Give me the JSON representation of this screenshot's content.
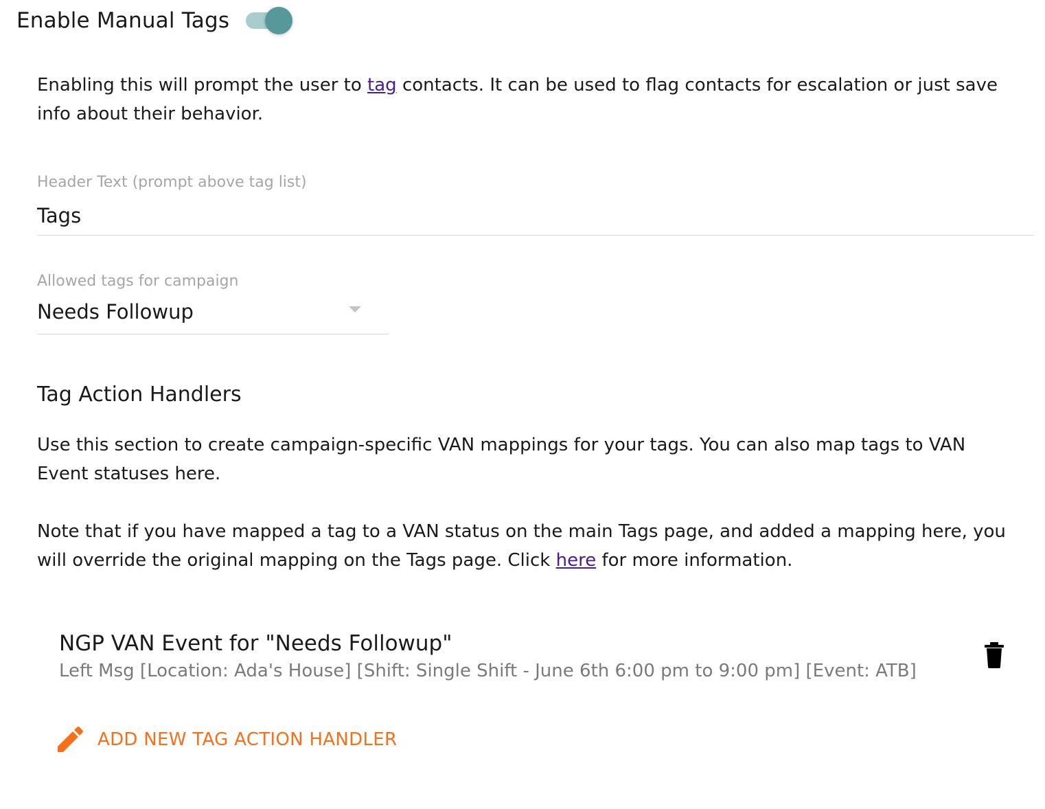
{
  "toggle": {
    "label": "Enable Manual Tags",
    "enabled": true,
    "colors": {
      "track": "#a9cccd",
      "thumb": "#57999b"
    }
  },
  "description": {
    "before_link": "Enabling this will prompt the user to ",
    "link_text": "tag",
    "after_link": " contacts. It can be used to flag contacts for escalation or just save info about their behavior."
  },
  "header_text_field": {
    "label": "Header Text (prompt above tag list)",
    "value": "Tags"
  },
  "allowed_tags_field": {
    "label": "Allowed tags for campaign",
    "value": "Needs Followup",
    "icon": "chevron-down-icon"
  },
  "tag_action_handlers": {
    "title": "Tag Action Handlers",
    "paragraph1": "Use this section to create campaign-specific VAN mappings for your tags. You can also map tags to VAN Event statuses here.",
    "paragraph2_before_link": "Note that if you have mapped a tag to a VAN status on the main Tags page, and added a mapping here, you will override the original mapping on the Tags page. Click ",
    "paragraph2_link": "here",
    "paragraph2_after_link": " for more information.",
    "items": [
      {
        "title": "NGP VAN Event for \"Needs Followup\"",
        "subtitle": "Left Msg [Location: Ada's House] [Shift: Single Shift - June 6th 6:00 pm to 9:00 pm] [Event: ATB]",
        "icon": "trash-icon"
      }
    ],
    "add_button_label": "ADD NEW TAG ACTION HANDLER",
    "add_button_icon": "pencil-icon",
    "colors": {
      "accent": "#f57119",
      "link": "#4b1c8f"
    }
  }
}
